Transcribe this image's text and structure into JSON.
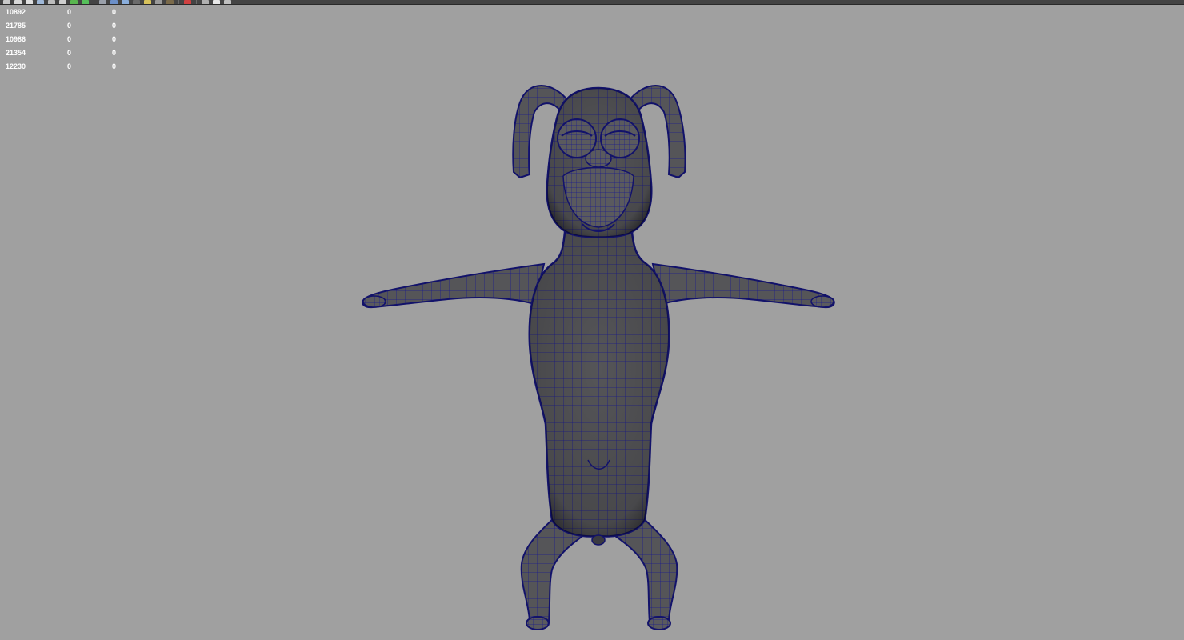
{
  "toolbar": {
    "icons": [
      {
        "name": "brush-icon",
        "color": "#c8c8c8"
      },
      {
        "name": "camera-icon",
        "color": "#d8d8d8"
      },
      {
        "name": "grid-icon",
        "color": "#e0e0e0"
      },
      {
        "name": "save-icon",
        "color": "#9fb8d8"
      },
      {
        "name": "render-icon",
        "color": "#bdbdbd"
      },
      {
        "name": "display-icon",
        "color": "#cfcfcf"
      },
      {
        "name": "green-flag-icon",
        "color": "#59b64f"
      },
      {
        "name": "green-check-icon",
        "color": "#55c05a"
      },
      {
        "name": "separator",
        "color": ""
      },
      {
        "name": "wireframe-icon",
        "color": "#9aa0aa"
      },
      {
        "name": "shaded-icon",
        "color": "#6b8fc8"
      },
      {
        "name": "smooth-shaded-icon",
        "color": "#8aaedc"
      },
      {
        "name": "textured-icon",
        "color": "#6a6a6a"
      },
      {
        "name": "light-icon",
        "color": "#d8c25a"
      },
      {
        "name": "shadow-icon",
        "color": "#9a9a9a"
      },
      {
        "name": "sphere-icon",
        "color": "#7a6a4a"
      },
      {
        "name": "separator",
        "color": ""
      },
      {
        "name": "isolate-icon",
        "color": "#d04040"
      },
      {
        "name": "separator",
        "color": ""
      },
      {
        "name": "xray-icon",
        "color": "#b0b0b0"
      },
      {
        "name": "xray-joints-icon",
        "color": "#e8e8e8"
      },
      {
        "name": "tool-settings-icon",
        "color": "#c0c0c0"
      }
    ]
  },
  "hud": {
    "rows": [
      {
        "value": "10892",
        "col2": "0",
        "col3": "0"
      },
      {
        "value": "21785",
        "col2": "0",
        "col3": "0"
      },
      {
        "value": "10986",
        "col2": "0",
        "col3": "0"
      },
      {
        "value": "21354",
        "col2": "0",
        "col3": "0"
      },
      {
        "value": "12230",
        "col2": "0",
        "col3": "0"
      }
    ]
  },
  "viewport": {
    "background": "#a0a0a0",
    "mesh_fill": "#555558",
    "wire_color": "#1a1a8c"
  }
}
